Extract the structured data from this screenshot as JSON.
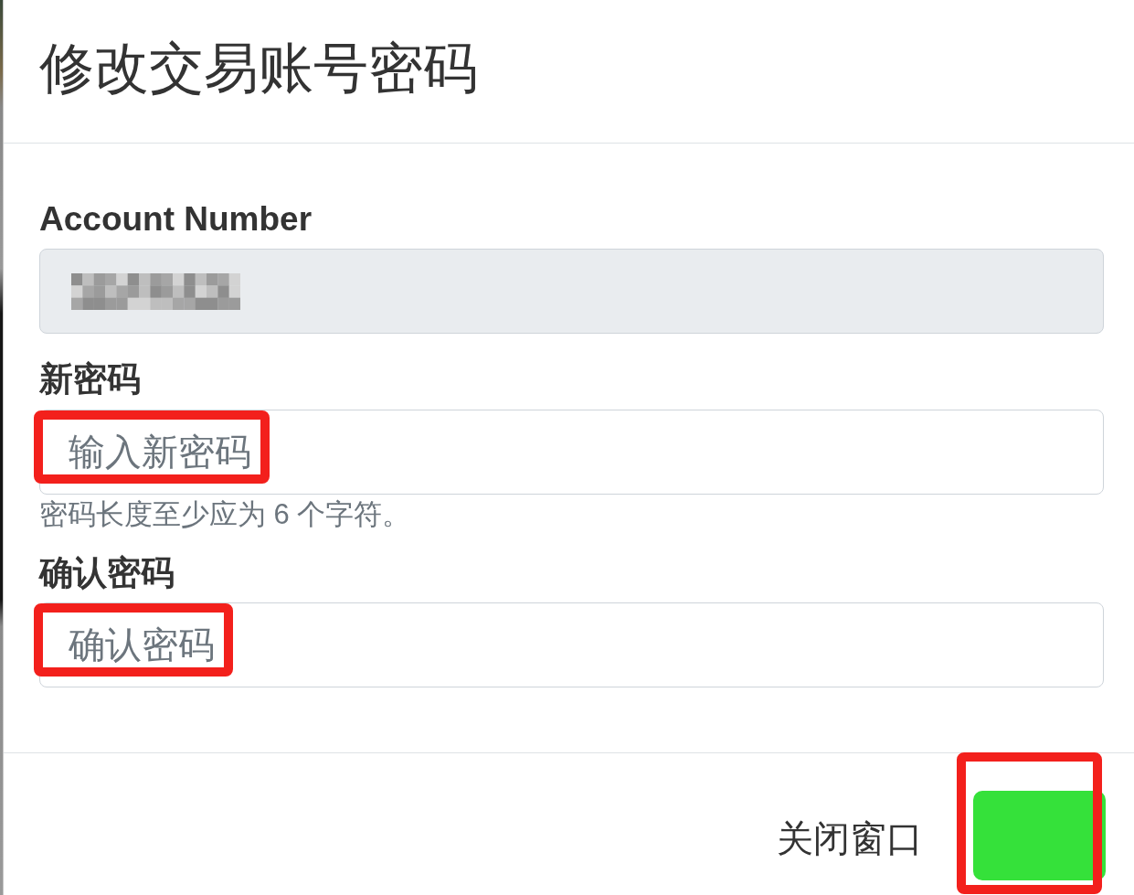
{
  "dialog": {
    "title": "修改交易账号密码"
  },
  "fields": [
    {
      "label": "Account Number",
      "readonly": true,
      "redacted": true,
      "highlighted": false
    },
    {
      "label": "新密码",
      "placeholder": "输入新密码",
      "readonly": false,
      "highlighted": true,
      "help": "密码长度至少应为 6 个字符。"
    },
    {
      "label": "确认密码",
      "placeholder": "确认密码",
      "readonly": false,
      "highlighted": true
    }
  ],
  "footer": {
    "buttons": [
      {
        "kind": "link",
        "label": "关闭窗口",
        "highlighted": false
      },
      {
        "kind": "submit",
        "highlighted": true
      }
    ]
  }
}
